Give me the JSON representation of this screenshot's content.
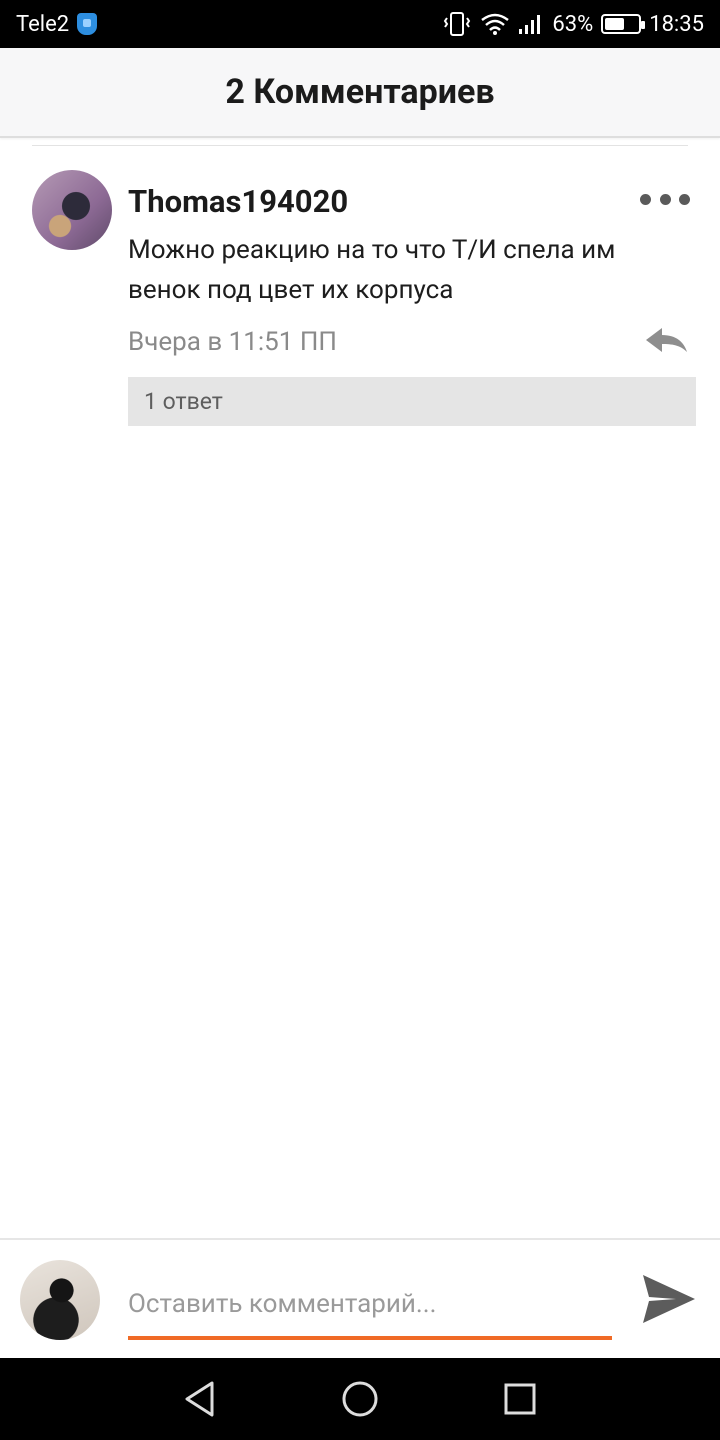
{
  "status_bar": {
    "carrier": "Tele2",
    "battery_percent": "63%",
    "battery_level": 0.63,
    "time": "18:35",
    "icons": [
      "shield-icon",
      "vibrate-icon",
      "wifi-icon",
      "signal-icon",
      "battery-icon"
    ]
  },
  "header": {
    "title": "2 Комментариев"
  },
  "comments": [
    {
      "username": "Thomas194020",
      "avatar": "cartoon-cat-avatar",
      "text": "Можно реакцию на то что Т/И спела им венок под цвет их корпуса",
      "timestamp": "Вчера в 11:51 ПП",
      "replies_label": "1 ответ",
      "icons": [
        "more-options-icon",
        "reply-icon"
      ]
    }
  ],
  "input": {
    "placeholder": "Оставить комментарий...",
    "value": "",
    "accent_color": "#f06a26",
    "icons": [
      "send-icon"
    ]
  },
  "nav_bar": {
    "icons": [
      "back-icon",
      "home-icon",
      "recents-icon"
    ]
  }
}
